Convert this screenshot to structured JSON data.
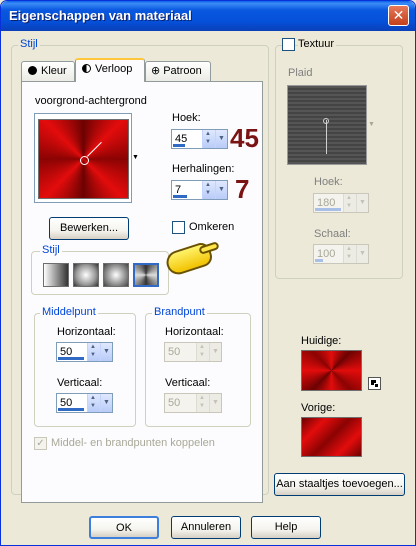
{
  "window": {
    "title": "Eigenschappen van materiaal",
    "close_label": "✕"
  },
  "left_group": {
    "label": "Stijl"
  },
  "tabs": [
    {
      "label": "Kleur",
      "icon": "circle-icon",
      "active": false
    },
    {
      "label": "Verloop",
      "icon": "half-circle-icon",
      "active": true
    },
    {
      "label": "Patroon",
      "icon": "pattern-icon",
      "active": false
    }
  ],
  "gradient": {
    "name": "voorgrond-achtergrond",
    "edit_button": "Bewerken...",
    "colors": {
      "primary": "#c80f0f",
      "dark": "#6c0202",
      "light": "#f4a4a4"
    }
  },
  "angle": {
    "label": "Hoek:",
    "value": "45",
    "annotation": "45"
  },
  "repeats": {
    "label": "Herhalingen:",
    "value": "7",
    "annotation": "7"
  },
  "invert": {
    "label": "Omkeren",
    "checked": false
  },
  "style_group": {
    "label": "Stijl",
    "selected_index": 3
  },
  "center_point": {
    "label": "Middelpunt",
    "horizontal_label": "Horizontaal:",
    "horizontal_value": "50",
    "vertical_label": "Verticaal:",
    "vertical_value": "50"
  },
  "focal_point": {
    "label": "Brandpunt",
    "horizontal_label": "Horizontaal:",
    "horizontal_value": "50",
    "vertical_label": "Verticaal:",
    "vertical_value": "50"
  },
  "link_points": {
    "label": "Middel- en brandpunten koppelen",
    "checked": true
  },
  "texture": {
    "label": "Textuur",
    "checked": false,
    "name": "Plaid",
    "angle_label": "Hoek:",
    "angle_value": "180",
    "scale_label": "Schaal:",
    "scale_value": "100"
  },
  "current": {
    "label": "Huidige:"
  },
  "previous": {
    "label": "Vorige:"
  },
  "add_swatch_button": "Aan staaltjes toevoegen...",
  "footer": {
    "ok": "OK",
    "cancel": "Annuleren",
    "help": "Help"
  },
  "annotation_color": "#7a1414"
}
